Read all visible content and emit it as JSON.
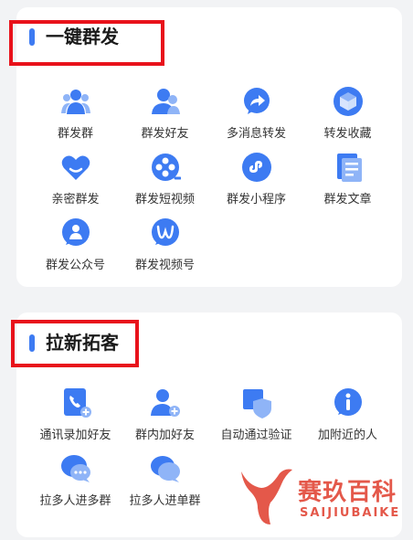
{
  "sections": [
    {
      "title": "一键群发",
      "items": [
        {
          "label": "群发群",
          "icon": "group-people-icon"
        },
        {
          "label": "群发好友",
          "icon": "friends-icon"
        },
        {
          "label": "多消息转发",
          "icon": "forward-icon"
        },
        {
          "label": "转发收藏",
          "icon": "cube-icon"
        },
        {
          "label": "亲密群发",
          "icon": "heart-icon"
        },
        {
          "label": "群发短视频",
          "icon": "film-reel-icon"
        },
        {
          "label": "群发小程序",
          "icon": "mini-program-icon"
        },
        {
          "label": "群发文章",
          "icon": "document-icon"
        },
        {
          "label": "群发公众号",
          "icon": "official-account-icon"
        },
        {
          "label": "群发视频号",
          "icon": "channels-icon"
        }
      ]
    },
    {
      "title": "拉新拓客",
      "items": [
        {
          "label": "通讯录加好友",
          "icon": "contacts-phone-icon"
        },
        {
          "label": "群内加好友",
          "icon": "add-person-icon"
        },
        {
          "label": "自动通过验证",
          "icon": "shield-check-icon"
        },
        {
          "label": "加附近的人",
          "icon": "nearby-info-icon"
        },
        {
          "label": "拉多人进多群",
          "icon": "chat-bubbles-icon"
        },
        {
          "label": "拉多人进单群",
          "icon": "chat-bubble-icon"
        }
      ]
    }
  ],
  "watermark": {
    "name_cn": "赛玖百科",
    "name_en": "SAIJIUBAIKE"
  },
  "colors": {
    "accent": "#3d7bf2",
    "icon_light": "#8fb4f7",
    "highlight_box": "#e8121b",
    "watermark": "#e4584a"
  }
}
